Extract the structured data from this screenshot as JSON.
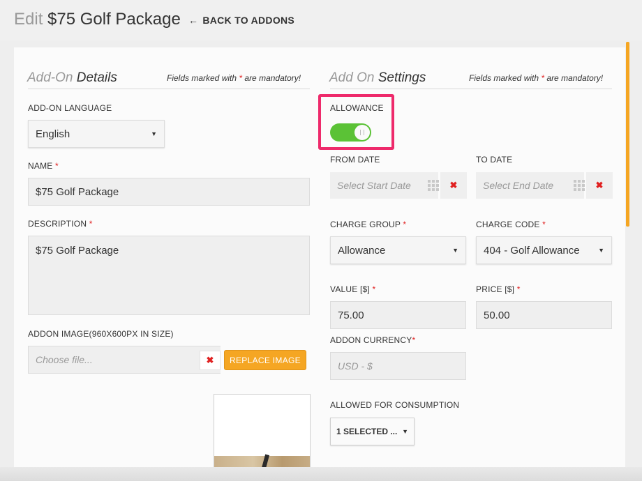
{
  "header": {
    "edit_word": "Edit",
    "title": "$75 Golf Package",
    "back_label": "BACK TO ADDONS",
    "back_icon": "arrow-left-icon"
  },
  "left": {
    "section_title_light": "Add-On",
    "section_title_bold": "Details",
    "mandatory_pre": "Fields marked with",
    "mandatory_star": "*",
    "mandatory_post": "are mandatory!",
    "language_label": "ADD-ON LANGUAGE",
    "language_value": "English",
    "name_label": "NAME",
    "name_value": "$75 Golf Package",
    "description_label": "DESCRIPTION",
    "description_value": "$75 Golf Package",
    "image_label": "ADDON IMAGE(960X600PX IN SIZE)",
    "file_placeholder": "Choose file...",
    "replace_button": "REPLACE IMAGE"
  },
  "right": {
    "section_title_light": "Add On",
    "section_title_bold": "Settings",
    "mandatory_pre": "Fields marked with",
    "mandatory_star": "*",
    "mandatory_post": "are mandatory!",
    "allowance_label": "ALLOWANCE",
    "allowance_on": true,
    "from_date_label": "FROM DATE",
    "from_date_placeholder": "Select Start Date",
    "to_date_label": "TO DATE",
    "to_date_placeholder": "Select End Date",
    "charge_group_label": "CHARGE GROUP",
    "charge_group_value": "Allowance",
    "charge_code_label": "CHARGE CODE",
    "charge_code_value": "404 - Golf Allowance",
    "value_label": "VALUE [$]",
    "value_value": "75.00",
    "price_label": "PRICE [$]",
    "price_value": "50.00",
    "currency_label": "ADDON CURRENCY",
    "currency_placeholder": "USD - $",
    "consumption_label": "ALLOWED FOR CONSUMPTION",
    "consumption_value": "1 SELECTED ..."
  },
  "required_star": "*",
  "colors": {
    "accent": "#f5a623",
    "toggle_on": "#5bc236",
    "highlight": "#ee2a6b",
    "required": "#e02020"
  }
}
